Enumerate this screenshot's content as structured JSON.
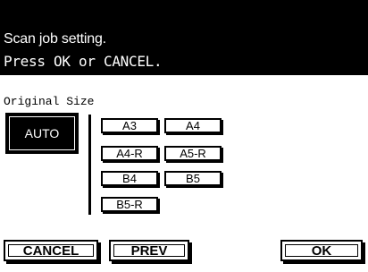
{
  "header": {
    "line1": "Scan job setting.",
    "line2": "Press OK or CANCEL."
  },
  "original_size": {
    "label": "Original Size",
    "auto_label": "AUTO",
    "sizes": [
      "A3",
      "A4",
      "A4-R",
      "A5-R",
      "B4",
      "B5",
      "B5-R"
    ]
  },
  "buttons": {
    "cancel": "CANCEL",
    "prev": "PREV",
    "ok": "OK"
  }
}
